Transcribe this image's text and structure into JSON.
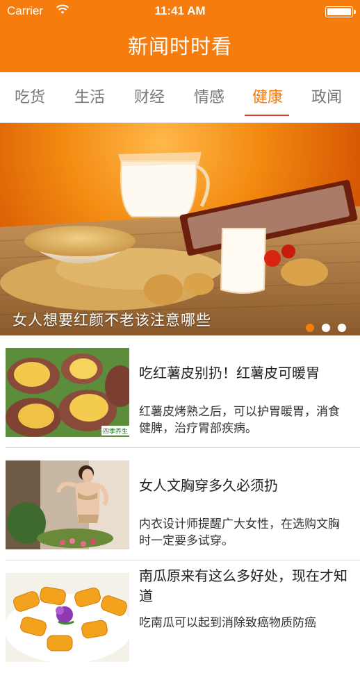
{
  "status_bar": {
    "carrier": "Carrier",
    "time": "11:41 AM",
    "wifi_icon": "wifi-icon",
    "battery_icon": "battery-icon"
  },
  "header": {
    "title": "新闻时时看"
  },
  "tabs": [
    {
      "label": "吃货",
      "active": false
    },
    {
      "label": "生活",
      "active": false
    },
    {
      "label": "财经",
      "active": false
    },
    {
      "label": "情感",
      "active": false
    },
    {
      "label": "健康",
      "active": true
    },
    {
      "label": "政闻",
      "active": false
    }
  ],
  "banner": {
    "caption": "女人想要红颜不老该注意哪些",
    "page_count": 3,
    "active_page": 0
  },
  "articles": [
    {
      "title": "吃红薯皮别扔！红薯皮可暖胃",
      "summary": "红薯皮烤熟之后，可以护胃暖胃，消食健脾，治疗胃部疾病。",
      "image_label": "四季养生"
    },
    {
      "title": "女人文胸穿多久必须扔",
      "summary": "内衣设计师提醒广大女性，在选购文胸时一定要多试穿。",
      "image_label": ""
    },
    {
      "title": "南瓜原来有这么多好处，现在才知道",
      "summary": "吃南瓜可以起到消除致癌物质防癌",
      "image_label": ""
    }
  ],
  "colors": {
    "accent": "#f77c0e",
    "underline": "#e53b2c"
  }
}
